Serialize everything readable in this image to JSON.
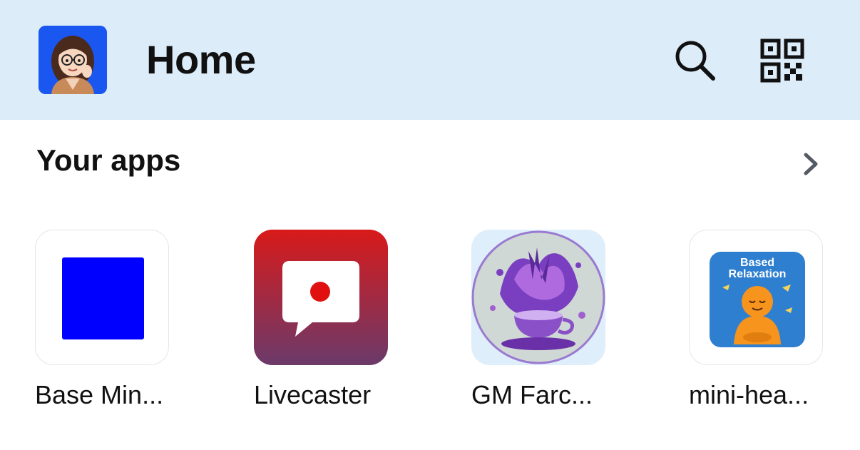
{
  "header": {
    "title": "Home",
    "avatar_icon": "avatar-cartoon-woman-glasses",
    "search_icon": "search-icon",
    "qr_icon": "qr-code-icon",
    "background": "#dcecf9"
  },
  "apps_section": {
    "title": "Your apps",
    "more_icon": "chevron-right-icon",
    "apps": [
      {
        "label": "Base Min...",
        "icon": "blue-square-icon"
      },
      {
        "label": "Livecaster",
        "icon": "live-chat-bubble-icon"
      },
      {
        "label": "GM Farc...",
        "icon": "purple-splash-cup-icon"
      },
      {
        "label": "mini-hea...",
        "icon": "based-relaxation-icon",
        "icon_text_line1": "Based",
        "icon_text_line2": "Relaxation"
      }
    ]
  },
  "colors": {
    "accent_blue": "#0000ff",
    "livecaster_red": "#d81a1a",
    "livecaster_purple": "#6b3a6a"
  }
}
